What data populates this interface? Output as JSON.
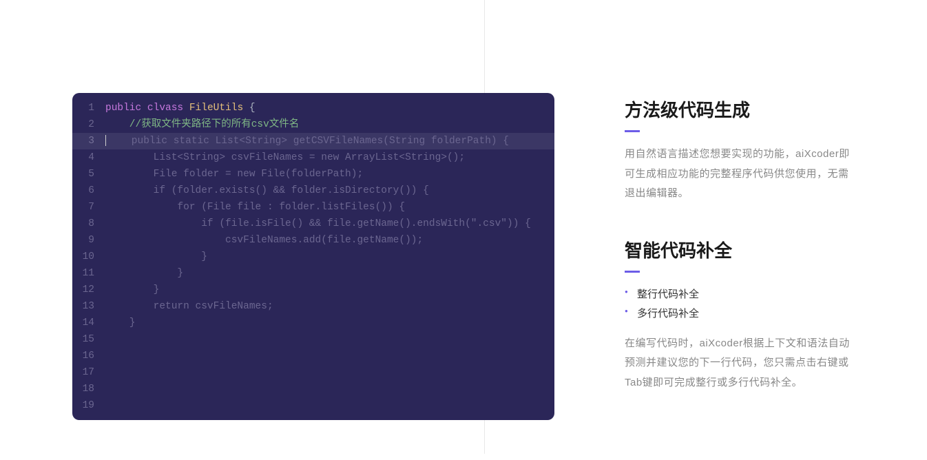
{
  "code": {
    "lineNumbers": [
      "1",
      "2",
      "3",
      "4",
      "5",
      "6",
      "7",
      "8",
      "9",
      "10",
      "11",
      "12",
      "13",
      "14",
      "15",
      "16",
      "17",
      "18",
      "19"
    ],
    "line1_kw1": "public",
    "line1_kw2": "clvass",
    "line1_class": "FileUtils",
    "line1_brace": " {",
    "line2_comment": "    //获取文件夹路径下的所有csv文件名",
    "line3_suggest": "    public static List<String> getCSVFileNames(String folderPath) {",
    "line4": "        List<String> csvFileNames = new ArrayList<String>();",
    "line5": "        File folder = new File(folderPath);",
    "line6": "        if (folder.exists() && folder.isDirectory()) {",
    "line7": "            for (File file : folder.listFiles()) {",
    "line8": "                if (file.isFile() && file.getName().endsWith(\".csv\")) {",
    "line9": "                    csvFileNames.add(file.getName());",
    "line10": "                }",
    "line11": "            }",
    "line12": "        }",
    "line13": "        return csvFileNames;",
    "line14": "    }"
  },
  "features": [
    {
      "title": "方法级代码生成",
      "desc": "用自然语言描述您想要实现的功能，aiXcoder即可生成相应功能的完整程序代码供您使用，无需退出编辑器。"
    },
    {
      "title": "智能代码补全",
      "bullets": [
        "整行代码补全",
        "多行代码补全"
      ],
      "desc": "在编写代码时，aiXcoder根据上下文和语法自动预测并建议您的下一行代码，您只需点击右键或Tab键即可完成整行或多行代码补全。"
    }
  ]
}
